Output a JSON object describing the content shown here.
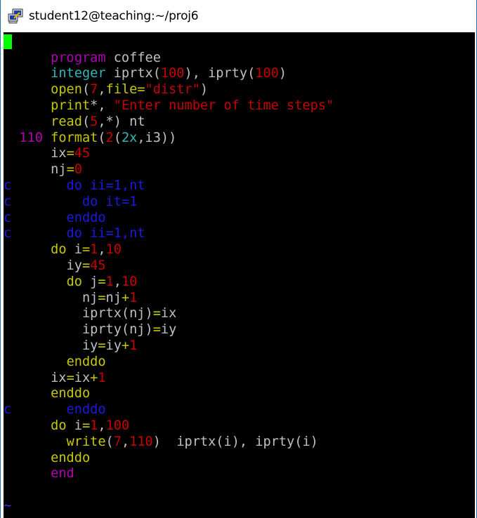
{
  "window": {
    "title": "student12@teaching:~/proj6"
  },
  "terminal": {
    "lines": [
      [
        {
          "t": "      ",
          "c": "txt"
        },
        {
          "t": "program",
          "c": "kw"
        },
        {
          "t": " coffee",
          "c": "txt"
        }
      ],
      [
        {
          "t": "      ",
          "c": "txt"
        },
        {
          "t": "integer",
          "c": "ty"
        },
        {
          "t": " iprtx(",
          "c": "txt"
        },
        {
          "t": "100",
          "c": "num"
        },
        {
          "t": "), iprty(",
          "c": "txt"
        },
        {
          "t": "100",
          "c": "num"
        },
        {
          "t": ")",
          "c": "txt"
        }
      ],
      [
        {
          "t": "      ",
          "c": "txt"
        },
        {
          "t": "open",
          "c": "fn"
        },
        {
          "t": "(",
          "c": "txt"
        },
        {
          "t": "7",
          "c": "num"
        },
        {
          "t": ",",
          "c": "txt"
        },
        {
          "t": "file=",
          "c": "fn"
        },
        {
          "t": "\"distr\"",
          "c": "str"
        },
        {
          "t": ")",
          "c": "txt"
        }
      ],
      [
        {
          "t": "      ",
          "c": "txt"
        },
        {
          "t": "print",
          "c": "fn"
        },
        {
          "t": "*, ",
          "c": "txt"
        },
        {
          "t": "\"Enter number of time steps\"",
          "c": "str"
        }
      ],
      [
        {
          "t": "      ",
          "c": "txt"
        },
        {
          "t": "read",
          "c": "fn"
        },
        {
          "t": "(",
          "c": "txt"
        },
        {
          "t": "5",
          "c": "num"
        },
        {
          "t": ",*) nt",
          "c": "txt"
        }
      ],
      [
        {
          "t": "  110 ",
          "c": "lbl"
        },
        {
          "t": "format",
          "c": "fn"
        },
        {
          "t": "(",
          "c": "txt"
        },
        {
          "t": "2",
          "c": "num"
        },
        {
          "t": "(",
          "c": "txt"
        },
        {
          "t": "2x",
          "c": "ty"
        },
        {
          "t": ",i3))",
          "c": "txt"
        }
      ],
      [
        {
          "t": "      ix",
          "c": "txt"
        },
        {
          "t": "=",
          "c": "op"
        },
        {
          "t": "45",
          "c": "num"
        }
      ],
      [
        {
          "t": "      nj",
          "c": "txt"
        },
        {
          "t": "=",
          "c": "op"
        },
        {
          "t": "0",
          "c": "num"
        }
      ],
      [
        {
          "t": "c       do ii=1,nt",
          "c": "cm"
        }
      ],
      [
        {
          "t": "c         do it=1",
          "c": "cm"
        }
      ],
      [
        {
          "t": "c       enddo",
          "c": "cm"
        }
      ],
      [
        {
          "t": "c       do ii=1,nt",
          "c": "cm"
        }
      ],
      [
        {
          "t": "      ",
          "c": "txt"
        },
        {
          "t": "do",
          "c": "fn"
        },
        {
          "t": " i",
          "c": "txt"
        },
        {
          "t": "=",
          "c": "op"
        },
        {
          "t": "1",
          "c": "num"
        },
        {
          "t": ",",
          "c": "txt"
        },
        {
          "t": "10",
          "c": "num"
        }
      ],
      [
        {
          "t": "        iy",
          "c": "txt"
        },
        {
          "t": "=",
          "c": "op"
        },
        {
          "t": "45",
          "c": "num"
        }
      ],
      [
        {
          "t": "        ",
          "c": "txt"
        },
        {
          "t": "do",
          "c": "fn"
        },
        {
          "t": " j",
          "c": "txt"
        },
        {
          "t": "=",
          "c": "op"
        },
        {
          "t": "1",
          "c": "num"
        },
        {
          "t": ",",
          "c": "txt"
        },
        {
          "t": "10",
          "c": "num"
        }
      ],
      [
        {
          "t": "          nj",
          "c": "txt"
        },
        {
          "t": "=",
          "c": "op"
        },
        {
          "t": "nj",
          "c": "txt"
        },
        {
          "t": "+",
          "c": "op"
        },
        {
          "t": "1",
          "c": "num"
        }
      ],
      [
        {
          "t": "          iprtx(nj)",
          "c": "txt"
        },
        {
          "t": "=",
          "c": "op"
        },
        {
          "t": "ix",
          "c": "txt"
        }
      ],
      [
        {
          "t": "          iprty(nj)",
          "c": "txt"
        },
        {
          "t": "=",
          "c": "op"
        },
        {
          "t": "iy",
          "c": "txt"
        }
      ],
      [
        {
          "t": "          iy",
          "c": "txt"
        },
        {
          "t": "=",
          "c": "op"
        },
        {
          "t": "iy",
          "c": "txt"
        },
        {
          "t": "+",
          "c": "op"
        },
        {
          "t": "1",
          "c": "num"
        }
      ],
      [
        {
          "t": "        ",
          "c": "txt"
        },
        {
          "t": "enddo",
          "c": "fn"
        }
      ],
      [
        {
          "t": "      ix",
          "c": "txt"
        },
        {
          "t": "=",
          "c": "op"
        },
        {
          "t": "ix",
          "c": "txt"
        },
        {
          "t": "+",
          "c": "op"
        },
        {
          "t": "1",
          "c": "num"
        }
      ],
      [
        {
          "t": "      ",
          "c": "txt"
        },
        {
          "t": "enddo",
          "c": "fn"
        }
      ],
      [
        {
          "t": "c       enddo",
          "c": "cm"
        }
      ],
      [
        {
          "t": "      ",
          "c": "txt"
        },
        {
          "t": "do",
          "c": "fn"
        },
        {
          "t": " i",
          "c": "txt"
        },
        {
          "t": "=",
          "c": "op"
        },
        {
          "t": "1",
          "c": "num"
        },
        {
          "t": ",",
          "c": "txt"
        },
        {
          "t": "100",
          "c": "num"
        }
      ],
      [
        {
          "t": "        ",
          "c": "txt"
        },
        {
          "t": "write",
          "c": "fn"
        },
        {
          "t": "(",
          "c": "txt"
        },
        {
          "t": "7",
          "c": "num"
        },
        {
          "t": ",",
          "c": "txt"
        },
        {
          "t": "110",
          "c": "num"
        },
        {
          "t": ")  iprtx(i), iprty(i)",
          "c": "txt"
        }
      ],
      [
        {
          "t": "      ",
          "c": "txt"
        },
        {
          "t": "enddo",
          "c": "fn"
        }
      ],
      [
        {
          "t": "      ",
          "c": "txt"
        },
        {
          "t": "end",
          "c": "kw"
        }
      ],
      [],
      [
        {
          "t": "~",
          "c": "tilde"
        }
      ],
      [
        {
          "t": "~",
          "c": "tilde"
        }
      ]
    ]
  },
  "colors": {
    "keyword": "#b000b0",
    "type": "#2fb8b8",
    "function": "#c8c800",
    "number": "#c80000",
    "string": "#c80000",
    "comment": "#1a1ae0",
    "text": "#c0c0c0",
    "cursor": "#00ff00",
    "background": "#000000"
  },
  "icons": {
    "app": "putty-terminal-icon"
  }
}
